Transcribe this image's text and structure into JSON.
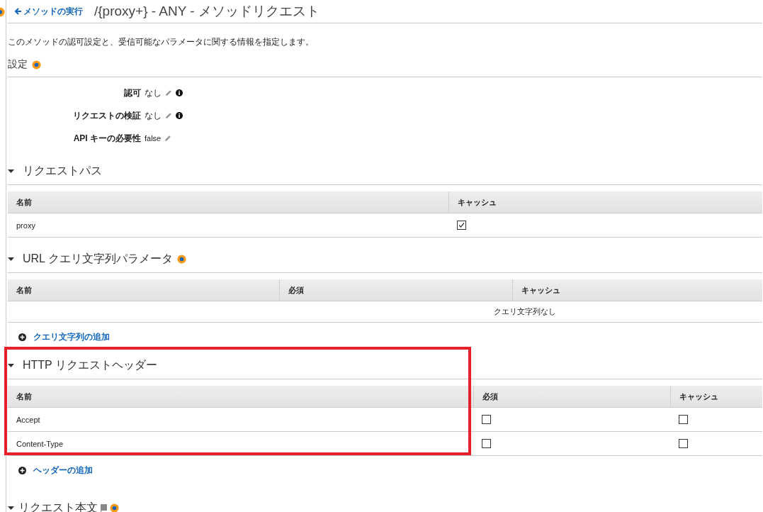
{
  "header": {
    "back_link": "メソッドの実行",
    "title": "/{proxy+} - ANY - メソッドリクエスト"
  },
  "description": "このメソッドの認可設定と、受信可能なパラメータに関する情報を指定します。",
  "settings": {
    "title": "設定",
    "rows": [
      {
        "label": "認可",
        "value": "なし",
        "info": true
      },
      {
        "label": "リクエストの検証",
        "value": "なし",
        "info": true
      },
      {
        "label": "API キーの必要性",
        "value": "false",
        "info": false
      }
    ]
  },
  "request_path": {
    "title": "リクエストパス",
    "expanded": true,
    "columns": [
      "名前",
      "キャッシュ"
    ],
    "rows": [
      {
        "name": "proxy",
        "cache": true
      }
    ]
  },
  "query_params": {
    "title": "URL クエリ文字列パラメータ",
    "expanded": true,
    "columns": [
      "名前",
      "必須",
      "キャッシュ"
    ],
    "empty_text": "クエリ文字列なし",
    "add_link": "クエリ文字列の追加"
  },
  "http_headers": {
    "title": "HTTP リクエストヘッダー",
    "expanded": true,
    "highlighted": true,
    "columns": [
      "名前",
      "必須",
      "キャッシュ"
    ],
    "rows": [
      {
        "name": "Accept",
        "required": false,
        "cache": false
      },
      {
        "name": "Content-Type",
        "required": false,
        "cache": false
      }
    ],
    "add_link": "ヘッダーの追加"
  },
  "request_body": {
    "title": "リクエスト本文",
    "expanded": true
  }
}
